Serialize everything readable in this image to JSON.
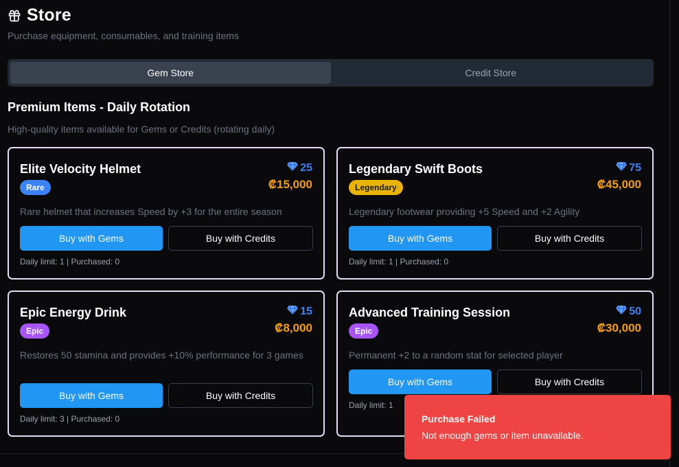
{
  "header": {
    "title": "Store",
    "subtitle": "Purchase equipment, consumables, and training items",
    "icon": "gift-icon"
  },
  "tabs": [
    {
      "label": "Gem Store",
      "active": true
    },
    {
      "label": "Credit Store",
      "active": false
    }
  ],
  "section": {
    "title": "Premium Items - Daily Rotation",
    "description": "High-quality items available for Gems or Credits (rotating daily)"
  },
  "items": [
    {
      "name": "Elite Velocity Helmet",
      "rarity": "Rare",
      "gem_price": "25",
      "credit_price": "₡15,000",
      "description": "Rare helmet that increases Speed by +3 for the entire season",
      "buy_gems_label": "Buy with Gems",
      "buy_credits_label": "Buy with Credits",
      "limits": "Daily limit: 1 | Purchased: 0"
    },
    {
      "name": "Legendary Swift Boots",
      "rarity": "Legendary",
      "gem_price": "75",
      "credit_price": "₡45,000",
      "description": "Legendary footwear providing +5 Speed and +2 Agility",
      "buy_gems_label": "Buy with Gems",
      "buy_credits_label": "Buy with Credits",
      "limits": "Daily limit: 1 | Purchased: 0"
    },
    {
      "name": "Epic Energy Drink",
      "rarity": "Epic",
      "gem_price": "15",
      "credit_price": "₡8,000",
      "description": "Restores 50 stamina and provides +10% performance for 3 games",
      "buy_gems_label": "Buy with Gems",
      "buy_credits_label": "Buy with Credits",
      "limits": "Daily limit: 3 | Purchased: 0"
    },
    {
      "name": "Advanced Training Session",
      "rarity": "Epic",
      "gem_price": "50",
      "credit_price": "₡30,000",
      "description": "Permanent +2 to a random stat for selected player",
      "buy_gems_label": "Buy with Gems",
      "buy_credits_label": "Buy with Credits",
      "limits": "Daily limit: 1"
    }
  ],
  "toast": {
    "title": "Purchase Failed",
    "message": "Not enough gems or item unavailable."
  },
  "colors": {
    "gem_blue": "#3b82f6",
    "credit_orange": "#f59e0b",
    "rare": "#3b82f6",
    "legendary": "#eab308",
    "epic": "#a855f7",
    "toast_red": "#ef4444"
  }
}
